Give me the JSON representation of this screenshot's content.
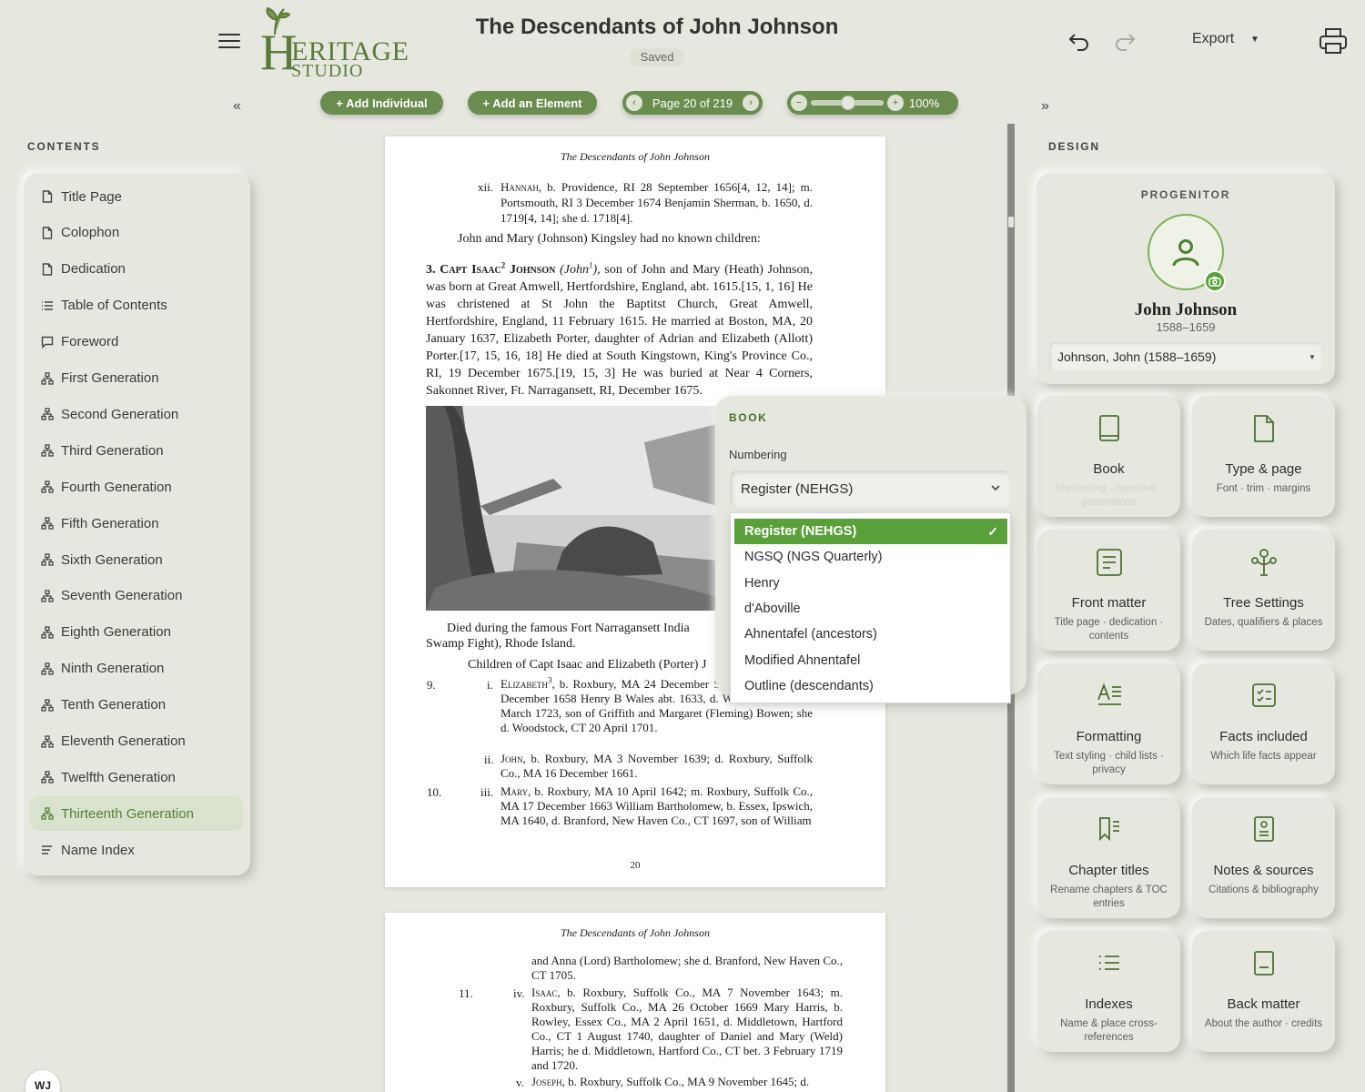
{
  "header": {
    "logo_initial": "H",
    "logo_word1": "ERITAGE",
    "logo_word2": "STUDIO",
    "title": "The Descendants of John Johnson",
    "status": "Saved",
    "export_label": "Export"
  },
  "toolbar": {
    "add_individual": "+ Add Individual",
    "add_element": "+ Add an Element",
    "page_label": "Page 20 of 219",
    "zoom": "100%",
    "prev": "‹",
    "next": "›",
    "zoom_minus": "−",
    "zoom_plus": "+",
    "collapse_left": "«",
    "collapse_right": "»"
  },
  "contents": {
    "label": "CONTENTS",
    "items": [
      {
        "label": "Title Page",
        "icon": "page-icon"
      },
      {
        "label": "Colophon",
        "icon": "page-icon"
      },
      {
        "label": "Dedication",
        "icon": "page-icon"
      },
      {
        "label": "Table of Contents",
        "icon": "list-icon"
      },
      {
        "label": "Foreword",
        "icon": "comment-icon"
      },
      {
        "label": "First Generation",
        "icon": "tree-icon"
      },
      {
        "label": "Second Generation",
        "icon": "tree-icon"
      },
      {
        "label": "Third Generation",
        "icon": "tree-icon"
      },
      {
        "label": "Fourth Generation",
        "icon": "tree-icon"
      },
      {
        "label": "Fifth Generation",
        "icon": "tree-icon"
      },
      {
        "label": "Sixth Generation",
        "icon": "tree-icon"
      },
      {
        "label": "Seventh Generation",
        "icon": "tree-icon"
      },
      {
        "label": "Eighth Generation",
        "icon": "tree-icon"
      },
      {
        "label": "Ninth Generation",
        "icon": "tree-icon"
      },
      {
        "label": "Tenth Generation",
        "icon": "tree-icon"
      },
      {
        "label": "Eleventh Generation",
        "icon": "tree-icon"
      },
      {
        "label": "Twelfth Generation",
        "icon": "tree-icon"
      },
      {
        "label": "Thirteenth Generation",
        "icon": "tree-icon",
        "active": true
      },
      {
        "label": "Name Index",
        "icon": "index-icon"
      }
    ]
  },
  "document": {
    "running_head": "The Descendants of John Johnson",
    "page_number": "20",
    "p1_xii_num": "xii.",
    "p1_xii_text": "b. Providence, RI 28 September 1656[4, 12, 14]; m. Portsmouth, RI 3 December 1674 Benjamin Sherman, b. 1650, d. 1719[4, 14]; she d. 1718[4].",
    "p1_kingsley": "John and Mary (Johnson) Kingsley had no known children:",
    "p1_isaac_text": "son of John and Mary (Heath) Johnson, was born at Great Amwell, Hertfordshire, England, abt. 1615.[15, 1, 16] He was christened at St John the Baptitst Church, Great Amwell, Hertfordshire, England, 11 February 1615. He married at Boston, MA, 20 January 1637, Elizabeth Porter, daughter of Adrian and Elizabeth (Allott) Porter.[17, 15, 16, 18] He died at South Kingstown, King's Province Co., RI, 19 December 1675.[19, 15, 3] He was buried at Near 4 Corners, Sakonnet River, Ft. Narragansett, RI, December 1675.",
    "p1_died": "Died during the famous Fort Narragansett India",
    "p1_swamp": "Swamp Fight), Rhode Island.",
    "p1_children": "Children of Capt Isaac and Elizabeth (Porter) J",
    "p1_c9_num": "9.",
    "p1_ci_num": "i.",
    "p1_ci_text": "b. Roxbury, MA 24 December Suffolk Co., MA 20 December 1658 Henry B Wales abt. 1633, d. Woodstock, CT 13 March 1723, son of Griffith and Margaret (Fleming) Bowen; she d. Woodstock, CT 20 April 1701.",
    "p1_cii_num": "ii.",
    "p1_cii_text": "b. Roxbury, MA 3 November 1639; d. Roxbury, Suffolk Co., MA 16 December 1661.",
    "p1_c10_num": "10.",
    "p1_ciii_num": "iii.",
    "p1_ciii_text": "b. Roxbury, MA 10 April 1642; m. Roxbury, Suffolk Co., MA 17 December 1663 William Bartholomew, b. Essex, Ipswich, MA 1640, d. Branford, New Haven Co., CT 1697, son of William",
    "p2_cont": "and Anna (Lord) Bartholomew; she d. Branford, New Haven Co., CT 1705.",
    "p2_c11_num": "11.",
    "p2_civ_num": "iv.",
    "p2_civ_text": "b. Roxbury, Suffolk Co., MA 7 November 1643; m. Roxbury, Suffolk Co., MA 26 October 1669 Mary Harris, b. Rowley, Essex Co., MA 2 April 1651, d. Middletown, Hartford Co., CT 1 August 1740, daughter of Daniel and Mary (Weld) Harris; he d. Middletown, Hartford Co., CT bet. 3 February 1719 and 1720.",
    "p2_cv_num": "v.",
    "p2_cv_text": "b. Roxbury, Suffolk Co., MA 9 November 1645; d."
  },
  "book_panel": {
    "label": "BOOK",
    "numbering_label": "Numbering",
    "selected": "Register (NEHGS)",
    "options": [
      "Register (NEHGS)",
      "NGSQ (NGS Quarterly)",
      "Henry",
      "d'Aboville",
      "Ahnentafel (ancestors)",
      "Modified Ahnentafel",
      "Outline (descendants)"
    ]
  },
  "design": {
    "label": "DESIGN",
    "progenitor_label": "PROGENITOR",
    "progenitor_name": "John Johnson",
    "progenitor_years": "1588–1659",
    "progenitor_select": "Johnson, John (1588–1659)",
    "cards": [
      {
        "title": "Book",
        "subtitle": "Numbering · narrative · generations",
        "icon": "book-icon"
      },
      {
        "title": "Type & page",
        "subtitle": "Font · trim · margins",
        "icon": "page-icon"
      },
      {
        "title": "Front matter",
        "subtitle": "Title page · dedication · contents",
        "icon": "document-lines-icon"
      },
      {
        "title": "Tree Settings",
        "subtitle": "Dates, qualifiers & places",
        "icon": "tree-node-icon"
      },
      {
        "title": "Formatting",
        "subtitle": "Text styling · child lists · privacy",
        "icon": "text-format-icon"
      },
      {
        "title": "Facts included",
        "subtitle": "Which life facts appear",
        "icon": "checklist-icon"
      },
      {
        "title": "Chapter titles",
        "subtitle": "Rename chapters & TOC entries",
        "icon": "bookmark-icon"
      },
      {
        "title": "Notes & sources",
        "subtitle": "Citations & bibliography",
        "icon": "notes-icon"
      },
      {
        "title": "Indexes",
        "subtitle": "Name & place cross-references",
        "icon": "index-list-icon"
      },
      {
        "title": "Back matter",
        "subtitle": "About the author · credits",
        "icon": "back-page-icon"
      }
    ]
  },
  "user": {
    "initials": "WJ"
  },
  "colors": {
    "accent": "#6a8c4e",
    "select": "#5aa03a",
    "bg": "#e6e8e0"
  }
}
